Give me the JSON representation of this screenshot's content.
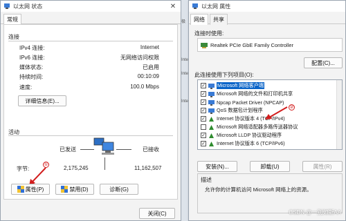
{
  "status_window": {
    "title": "以太网 状态",
    "tab_general": "常规",
    "connection": {
      "label": "连接",
      "rows": [
        {
          "key": "IPv4 连接:",
          "value": "Internet"
        },
        {
          "key": "IPv6 连接:",
          "value": "无网络访问权限"
        },
        {
          "key": "媒体状态:",
          "value": "已启用"
        },
        {
          "key": "持续时间:",
          "value": "00:10:09"
        },
        {
          "key": "速度:",
          "value": "100.0 Mbps"
        }
      ],
      "details_button": "详细信息(E)..."
    },
    "activity": {
      "label": "活动",
      "sent_label": "已发送",
      "received_label": "已接收",
      "bytes_label": "字节:",
      "sent_value": "2,175,245",
      "received_value": "11,162,507"
    },
    "buttons": {
      "properties": "属性(P)",
      "disable": "禁用(D)",
      "diagnose": "诊断(G)",
      "close": "关闭(C)"
    },
    "marker_1": "①"
  },
  "properties_window": {
    "title": "以太网 属性",
    "tabs": [
      "网络",
      "共享"
    ],
    "connect_using_label": "连接时使用:",
    "adapter_name": "Realtek PCIe GbE Family Controller",
    "configure_button": "配置(C)...",
    "items_label": "此连接使用下列项目(O):",
    "items": [
      {
        "label": "Microsoft 网络客户端",
        "checked": true,
        "selected": true
      },
      {
        "label": "Microsoft 网络的文件和打印机共享",
        "checked": true,
        "selected": false
      },
      {
        "label": "Npcap Packet Driver (NPCAP)",
        "checked": true,
        "selected": false
      },
      {
        "label": "QoS 数据包计划程序",
        "checked": true,
        "selected": false
      },
      {
        "label": "Internet 协议版本 4 (TCP/IPv4)",
        "checked": true,
        "selected": false
      },
      {
        "label": "Microsoft 网络适配器多路传送器协议",
        "checked": false,
        "selected": false
      },
      {
        "label": "Microsoft LLDP 协议驱动程序",
        "checked": true,
        "selected": false
      },
      {
        "label": "Internet 协议版本 6 (TCP/IPv6)",
        "checked": true,
        "selected": false
      }
    ],
    "install_button": "安装(N)...",
    "uninstall_button": "卸载(U)",
    "properties_button": "属性(R)",
    "description_label": "描述",
    "description_text": "允许你的计算机访问 Microsoft 网络上的资源。",
    "marker_2": "②"
  },
  "background_sliver": [
    "极",
    "Inte",
    "Inte",
    "Inte"
  ],
  "watermark": "CSDN @一别如斯AA",
  "colors": {
    "accent": "#0a64c8",
    "annotation_red": "#d21d1d"
  }
}
